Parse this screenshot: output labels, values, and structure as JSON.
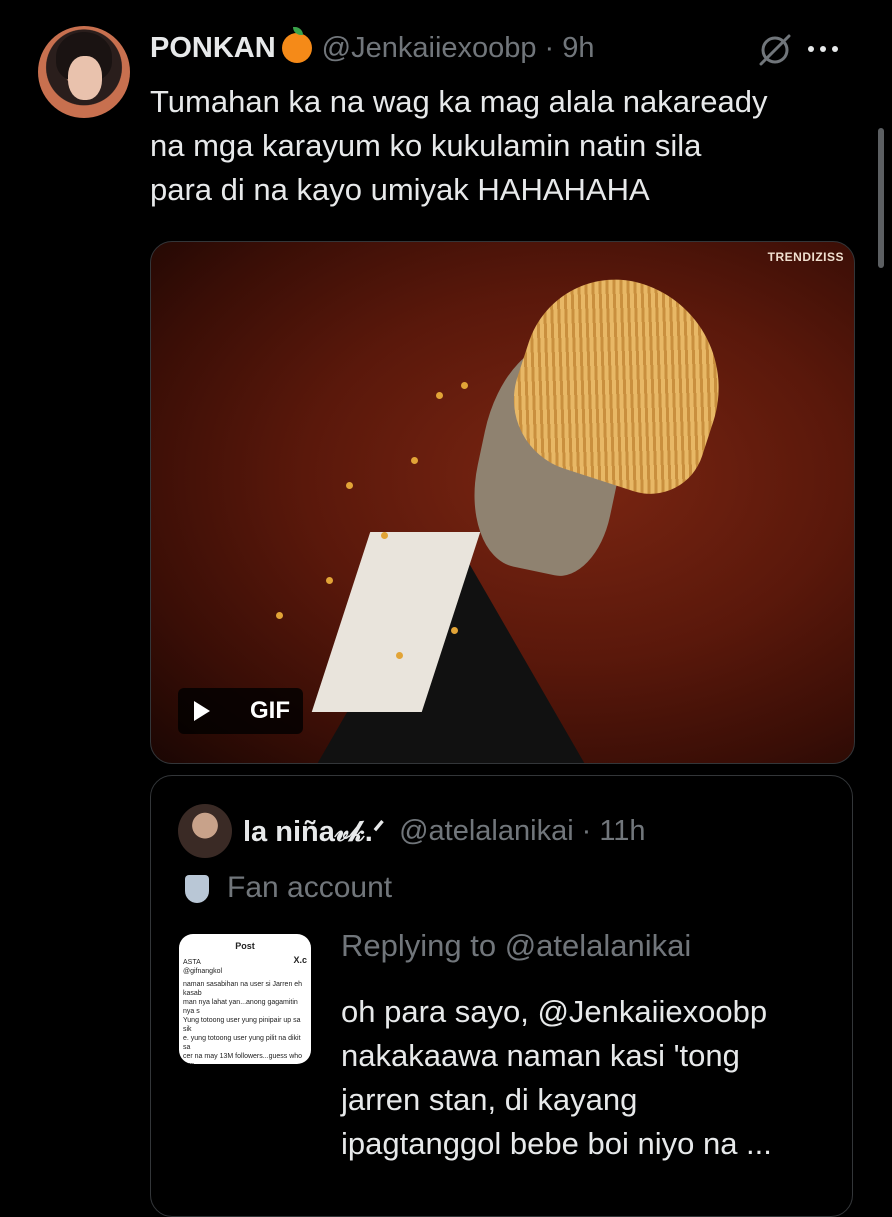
{
  "tweet": {
    "display_name": "PONKAN",
    "handle": "@Jenkaiiexoobp",
    "separator": "·",
    "time": "9h",
    "text": "Tumahan ka na wag ka mag alala nakaready\nna mga karayum ko kukulamin natin sila\npara di na kayo umiyak HAHAHAHA",
    "icons": [
      "orange-emoji",
      "grok-icon",
      "more-icon"
    ]
  },
  "media": {
    "watermark": "TRENDIZISS",
    "badge_label": "GIF"
  },
  "quote": {
    "display_name": "la niña𝓋𝓀.ᐟ",
    "handle": "@atelalanikai",
    "separator": "·",
    "time": "11h",
    "account_label": "Fan account",
    "reply_to": "Replying to @atelalanikai",
    "text": "oh para sayo, @Jenkaiiexoobp\nnakakaawa naman kasi 'tong\njarren stan, di kayang\nipagtanggol bebe boi niyo na ...",
    "thumbnail": {
      "title": "Post",
      "x_logo": "X.c",
      "user_name": "ASTA",
      "user_handle": "@gifnangkol",
      "body": "naman sasabihan na user si Jarren eh kasab\nman nya lahat yan...anong gagamitin nya s\nYung totoong user yung pinipair up sa sik\ne. yung totoong user yung pilit na dikit sa\ncer na may 13M followers...guess who kun\nn..haha"
    }
  },
  "colors": {
    "background": "#000000",
    "text": "#e7e9ea",
    "muted": "#71767b",
    "border": "#333639"
  }
}
